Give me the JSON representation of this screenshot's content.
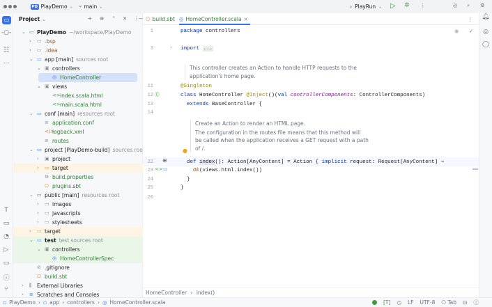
{
  "titlebar": {
    "project": "PlayDemo",
    "project_badge": "PD",
    "branch": "main",
    "run_config": "PlayRun"
  },
  "project_panel": {
    "title": "Project"
  },
  "tabs": [
    {
      "label": "build.sbt",
      "active": false
    },
    {
      "label": "HomeController.scala",
      "active": true
    }
  ],
  "tree": [
    {
      "level": 0,
      "expanded": true,
      "icon": "module",
      "label": "PlayDemo",
      "suffix": "~/workspace/PlayDemo",
      "bold": true
    },
    {
      "level": 1,
      "expanded": false,
      "icon": "folder",
      "label": ".bsp",
      "color": "#8f5a2e"
    },
    {
      "level": 1,
      "expanded": false,
      "icon": "folder",
      "label": ".idea",
      "color": "#8f5a2e"
    },
    {
      "level": 1,
      "expanded": true,
      "icon": "module",
      "label": "app [main]",
      "suffix": "sources root"
    },
    {
      "level": 2,
      "expanded": true,
      "icon": "package",
      "label": "controllers"
    },
    {
      "level": 3,
      "icon": "scala-class",
      "label": "HomeController",
      "color": "#2f7d32",
      "selected": true
    },
    {
      "level": 2,
      "expanded": true,
      "icon": "package",
      "label": "views"
    },
    {
      "level": 3,
      "icon": "template",
      "label": "index.scala.html",
      "color": "#2f7d32"
    },
    {
      "level": 3,
      "icon": "template",
      "label": "main.scala.html",
      "color": "#2f7d32"
    },
    {
      "level": 1,
      "expanded": true,
      "icon": "module",
      "label": "conf [main]",
      "suffix": "resources root"
    },
    {
      "level": 2,
      "icon": "text-file",
      "label": "application.conf",
      "color": "#2f7d32"
    },
    {
      "level": 2,
      "icon": "xml",
      "label": "logback.xml",
      "color": "#2f7d32"
    },
    {
      "level": 2,
      "icon": "text-file",
      "label": "routes",
      "color": "#2f7d32"
    },
    {
      "level": 1,
      "expanded": true,
      "icon": "module",
      "label": "project [PlayDemo-build]",
      "suffix": "sources root"
    },
    {
      "level": 2,
      "expanded": false,
      "icon": "package",
      "label": "project"
    },
    {
      "level": 2,
      "expanded": false,
      "icon": "folder-excluded",
      "label": "target",
      "bg": "#fdf4e3"
    },
    {
      "level": 2,
      "icon": "gear-file",
      "label": "build.properties",
      "color": "#2f7d32"
    },
    {
      "level": 2,
      "icon": "sbt",
      "label": "plugins.sbt",
      "color": "#2f7d32"
    },
    {
      "level": 1,
      "expanded": true,
      "icon": "module",
      "label": "public [main]",
      "suffix": "resources root"
    },
    {
      "level": 2,
      "expanded": false,
      "icon": "folder",
      "label": "images"
    },
    {
      "level": 2,
      "expanded": false,
      "icon": "folder",
      "label": "javascripts"
    },
    {
      "level": 2,
      "expanded": false,
      "icon": "folder",
      "label": "stylesheets"
    },
    {
      "level": 1,
      "expanded": false,
      "icon": "folder-excluded",
      "label": "target",
      "bg": "#fdf4e3"
    },
    {
      "level": 1,
      "expanded": true,
      "icon": "module",
      "label": "test",
      "suffix": "test sources root",
      "bg": "#eaf6e8",
      "boldlbl": true
    },
    {
      "level": 2,
      "expanded": true,
      "icon": "package",
      "label": "controllers",
      "bg": "#eaf6e8"
    },
    {
      "level": 3,
      "icon": "scala-class",
      "label": "HomeControllerSpec",
      "color": "#2f7d32",
      "bg": "#eaf6e8"
    },
    {
      "level": 1,
      "icon": "ignore-file",
      "label": ".gitignore"
    },
    {
      "level": 1,
      "icon": "sbt",
      "label": "build.sbt",
      "color": "#2f7d32"
    },
    {
      "level": 0,
      "expanded": false,
      "icon": "library",
      "label": "External Libraries"
    },
    {
      "level": 0,
      "expanded": false,
      "icon": "scratches",
      "label": "Scratches and Consoles"
    }
  ],
  "editor": {
    "lines": {
      "l1": "1",
      "l3": "3",
      "l11": "11",
      "l12": "12",
      "l13": "13",
      "l14": "14",
      "l22": "22",
      "l23": "23",
      "l24": "24",
      "l25": "25",
      "l26": "26"
    },
    "code": {
      "pkg_kw": "package",
      "pkg": " controllers",
      "import_kw": "import",
      "import_fold": "...",
      "singleton": "@Singleton",
      "class_kw": "class",
      "class_name": " HomeController ",
      "inject": "@Inject",
      "paren": "()(",
      "val_kw": "val",
      "param": " controllerComponents",
      "param_type": ": ControllerComponents)",
      "extends_kw": "extends",
      "base": " BaseController {",
      "def_kw": "def",
      "index": "index",
      "sig": "(): Action[AnyContent] = Action { ",
      "implicit_kw": "implicit",
      "req": " request: Request[AnyContent] ⇒",
      "ok": "Ok",
      "ok_rest": "(views.html.index())",
      "close1": "}",
      "close2": "}"
    },
    "doc1": "This controller creates an Action to handle HTTP requests to the application's home page.",
    "doc2_l1": "Create an Action to render an HTML page.",
    "doc2_l2": "The configuration in the routes file means that this method will",
    "doc2_l3": "be called when the application receives a GET request with a path",
    "doc2_l4": "of /.",
    "breadcrumb": [
      "HomeController",
      "index()"
    ]
  },
  "nav_breadcrumb": [
    "PlayDemo",
    "app",
    "controllers",
    "HomeController.scala"
  ],
  "status": {
    "typing": "[T]",
    "line_sep": "LF",
    "encoding": "UTF-8",
    "indent": "Tab"
  }
}
